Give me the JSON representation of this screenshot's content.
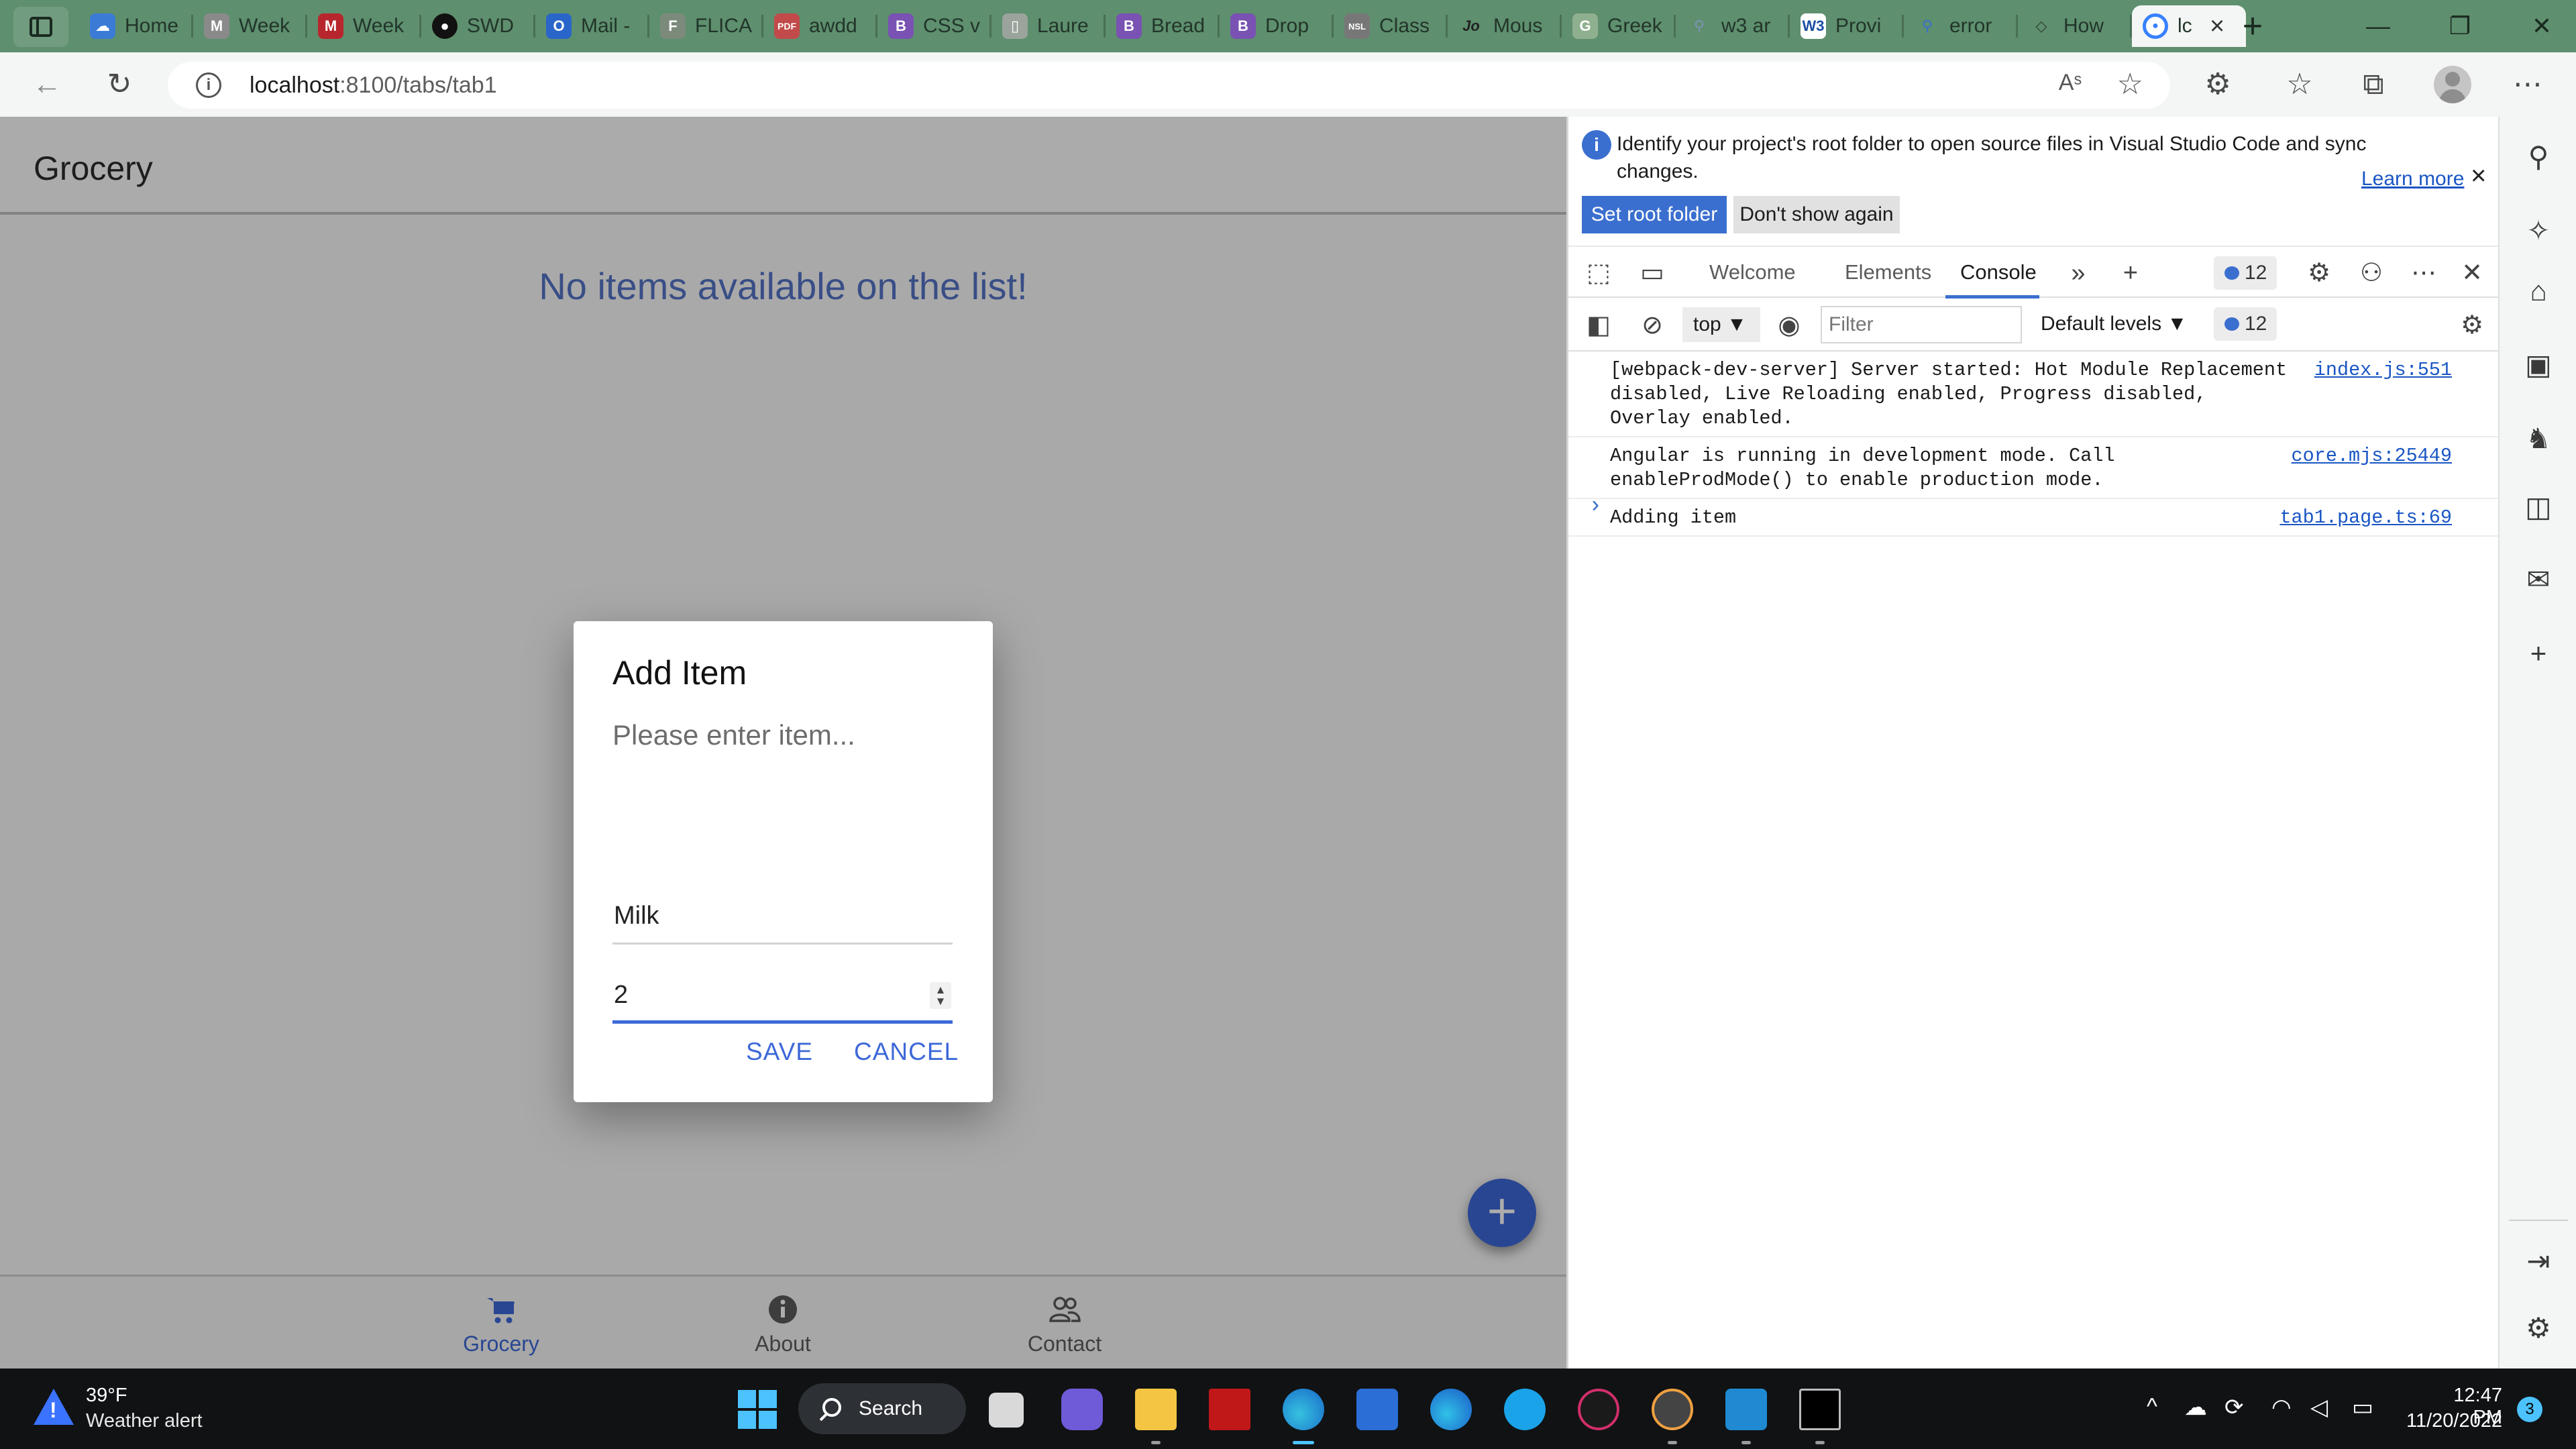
{
  "browser": {
    "tabs": [
      {
        "label": "Home",
        "favicon": "onedrive-icon",
        "color": "#3b7bd6"
      },
      {
        "label": "Week",
        "favicon": "gmail-icon",
        "color": "#8a8a8a"
      },
      {
        "label": "Week",
        "favicon": "gmail-icon",
        "color": "#b8262d"
      },
      {
        "label": "SWD",
        "favicon": "github-icon",
        "color": "#111111"
      },
      {
        "label": "Mail -",
        "favicon": "outlook-icon",
        "color": "#2a66c9"
      },
      {
        "label": "FLICA",
        "favicon": "flica-icon",
        "color": "#7c8a7c"
      },
      {
        "label": "awdd",
        "favicon": "pdf-icon",
        "color": "#c24a4a"
      },
      {
        "label": "CSS v",
        "favicon": "bootstrap-icon",
        "color": "#7952b3"
      },
      {
        "label": "Laure",
        "favicon": "document-icon",
        "color": "#9aa39c"
      },
      {
        "label": "Bread",
        "favicon": "bootstrap-icon",
        "color": "#7952b3"
      },
      {
        "label": "Drop",
        "favicon": "bootstrap-icon",
        "color": "#7952b3"
      },
      {
        "label": "Class",
        "favicon": "nsl-icon",
        "color": "#777777"
      },
      {
        "label": "Mous",
        "favicon": "javascript-icon",
        "color": "#333333"
      },
      {
        "label": "Greek",
        "favicon": "geeksforgeeks-icon",
        "color": "#8fb08f"
      },
      {
        "label": "w3 ar",
        "favicon": "search-icon",
        "color": "#7d93b5"
      },
      {
        "label": "Provi",
        "favicon": "w3schools-icon",
        "color": "#1b4fa3"
      },
      {
        "label": "error",
        "favicon": "search-icon",
        "color": "#3a6fd0"
      },
      {
        "label": "How",
        "favicon": "stackoverflow-icon",
        "color": "#2f3f35"
      }
    ],
    "active_tab": {
      "label": "lc",
      "favicon": "ionic-icon",
      "color": "#3880ff"
    },
    "new_tab_glyph": "+",
    "url_host": "localhost",
    "url_path": ":8100/tabs/tab1",
    "read_aloud": "Aˢ"
  },
  "app": {
    "title": "Grocery",
    "empty_message": "No items available on the list!",
    "fab_glyph": "+",
    "tabs": [
      {
        "label": "Grocery",
        "icon": "cart-icon"
      },
      {
        "label": "About",
        "icon": "information-circle-icon"
      },
      {
        "label": "Contact",
        "icon": "people-icon"
      }
    ]
  },
  "dialog": {
    "title": "Add Item",
    "message": "Please enter item...",
    "inputs": [
      {
        "value": "Milk"
      },
      {
        "value": "2"
      }
    ],
    "buttons": {
      "save": "SAVE",
      "cancel": "CANCEL"
    }
  },
  "devtools": {
    "infobar": {
      "text": "Identify your project's root folder to open source files in Visual Studio Code and sync changes.",
      "learn_more": "Learn more",
      "set_root": "Set root folder",
      "dont_show": "Don't show again"
    },
    "tabs": {
      "welcome": "Welcome",
      "elements": "Elements",
      "console": "Console"
    },
    "issue_count": "12",
    "console_bar": {
      "context": "top",
      "filter_placeholder": "Filter",
      "levels": "Default levels",
      "issue_count": "12"
    },
    "logs": [
      {
        "message": "[webpack-dev-server] Server started: Hot Module Replacement disabled, Live Reloading enabled, Progress disabled, Overlay enabled.",
        "source": "index.js:551"
      },
      {
        "message": "Angular is running in development mode. Call enableProdMode() to enable production mode.",
        "source": "core.mjs:25449"
      },
      {
        "message": "Adding item",
        "source": "tab1.page.ts:69"
      }
    ],
    "prompt": "›"
  },
  "taskbar": {
    "weather_temp": "39°F",
    "weather_alert": "Weather alert",
    "search_label": "Search",
    "time": "12:47 PM",
    "date": "11/20/2022",
    "notification_count": "3"
  }
}
